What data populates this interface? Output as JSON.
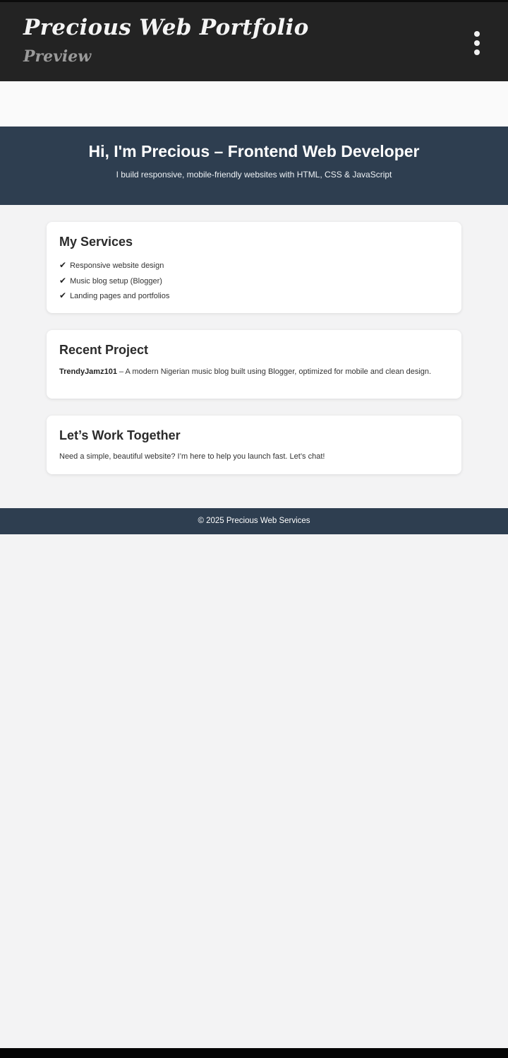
{
  "app": {
    "title": "Precious Web Portfolio",
    "subtitle": "Preview",
    "menu_icon": "more-vertical-icon"
  },
  "hero": {
    "title": "Hi, I'm Precious – Frontend Web Developer",
    "subtitle": "I build responsive, mobile-friendly websites with HTML, CSS & JavaScript"
  },
  "services": {
    "heading": "My Services",
    "check_glyph": "✔",
    "items": [
      "Responsive website design",
      "Music blog setup (Blogger)",
      "Landing pages and portfolios"
    ]
  },
  "project": {
    "heading": "Recent Project",
    "name": "TrendyJamz101",
    "description": " – A modern Nigerian music blog built using Blogger, optimized for mobile and clean design."
  },
  "contact": {
    "heading": "Let’s Work Together",
    "text": "Need a simple, beautiful website? I’m here to help you launch fast. Let’s chat!"
  },
  "footer": {
    "text": "© 2025 Precious Web Services"
  },
  "colors": {
    "header_bg": "#232323",
    "hero_bg": "#2e3e50",
    "page_bg": "#f3f3f4",
    "card_bg": "#ffffff"
  }
}
